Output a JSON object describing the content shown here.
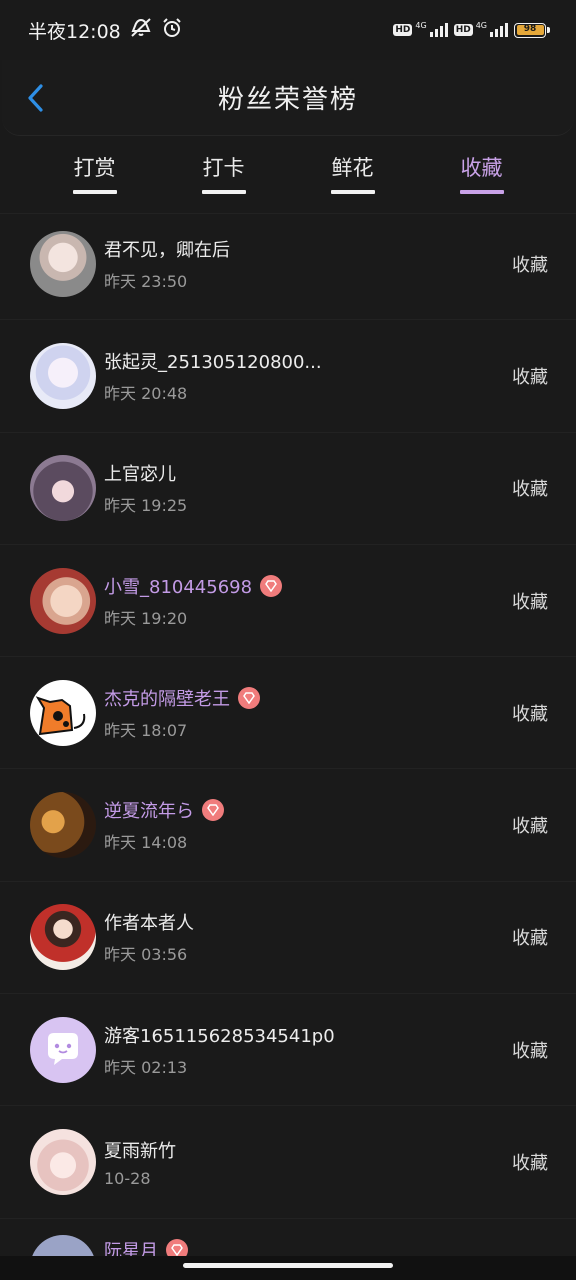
{
  "status": {
    "time": "半夜12:08",
    "signal1_type": "4G",
    "signal2_type": "4G",
    "hd1": "HD",
    "hd2": "HD",
    "battery": "98"
  },
  "header": {
    "title": "粉丝荣誉榜"
  },
  "tabs": [
    {
      "label": "打赏",
      "active": false
    },
    {
      "label": "打卡",
      "active": false
    },
    {
      "label": "鲜花",
      "active": false
    },
    {
      "label": "收藏",
      "active": true
    }
  ],
  "colors": {
    "accent": "#c9a2e8",
    "vip_name": "#c39be6",
    "badge": "#f07c7c",
    "background": "#1a1a1a"
  },
  "fans": [
    {
      "name": "君不见，卿在后",
      "time": "昨天 23:50",
      "action": "收藏",
      "vip": false,
      "avatar_icon": "avatar-photo-icon"
    },
    {
      "name": "张起灵_251305120800...",
      "time": "昨天 20:48",
      "action": "收藏",
      "vip": false,
      "avatar_icon": "avatar-anime-icon"
    },
    {
      "name": "上官宓儿",
      "time": "昨天 19:25",
      "action": "收藏",
      "vip": false,
      "avatar_icon": "avatar-anime-icon"
    },
    {
      "name": "小雪_810445698",
      "time": "昨天 19:20",
      "action": "收藏",
      "vip": true,
      "avatar_icon": "avatar-baby-icon"
    },
    {
      "name": "杰克的隔壁老王",
      "time": "昨天 18:07",
      "action": "收藏",
      "vip": true,
      "avatar_icon": "avatar-cat-icon"
    },
    {
      "name": "逆夏流年ら",
      "time": "昨天 14:08",
      "action": "收藏",
      "vip": true,
      "avatar_icon": "avatar-photo-icon"
    },
    {
      "name": "作者本者人",
      "time": "昨天 03:56",
      "action": "收藏",
      "vip": false,
      "avatar_icon": "avatar-illustration-icon"
    },
    {
      "name": "游客165115628534541p0",
      "time": "昨天 02:13",
      "action": "收藏",
      "vip": false,
      "avatar_icon": "avatar-chat-icon"
    },
    {
      "name": "夏雨新竹",
      "time": "10-28",
      "action": "收藏",
      "vip": false,
      "avatar_icon": "avatar-anime-icon"
    }
  ],
  "partial_row": {
    "name": "阮星月"
  }
}
